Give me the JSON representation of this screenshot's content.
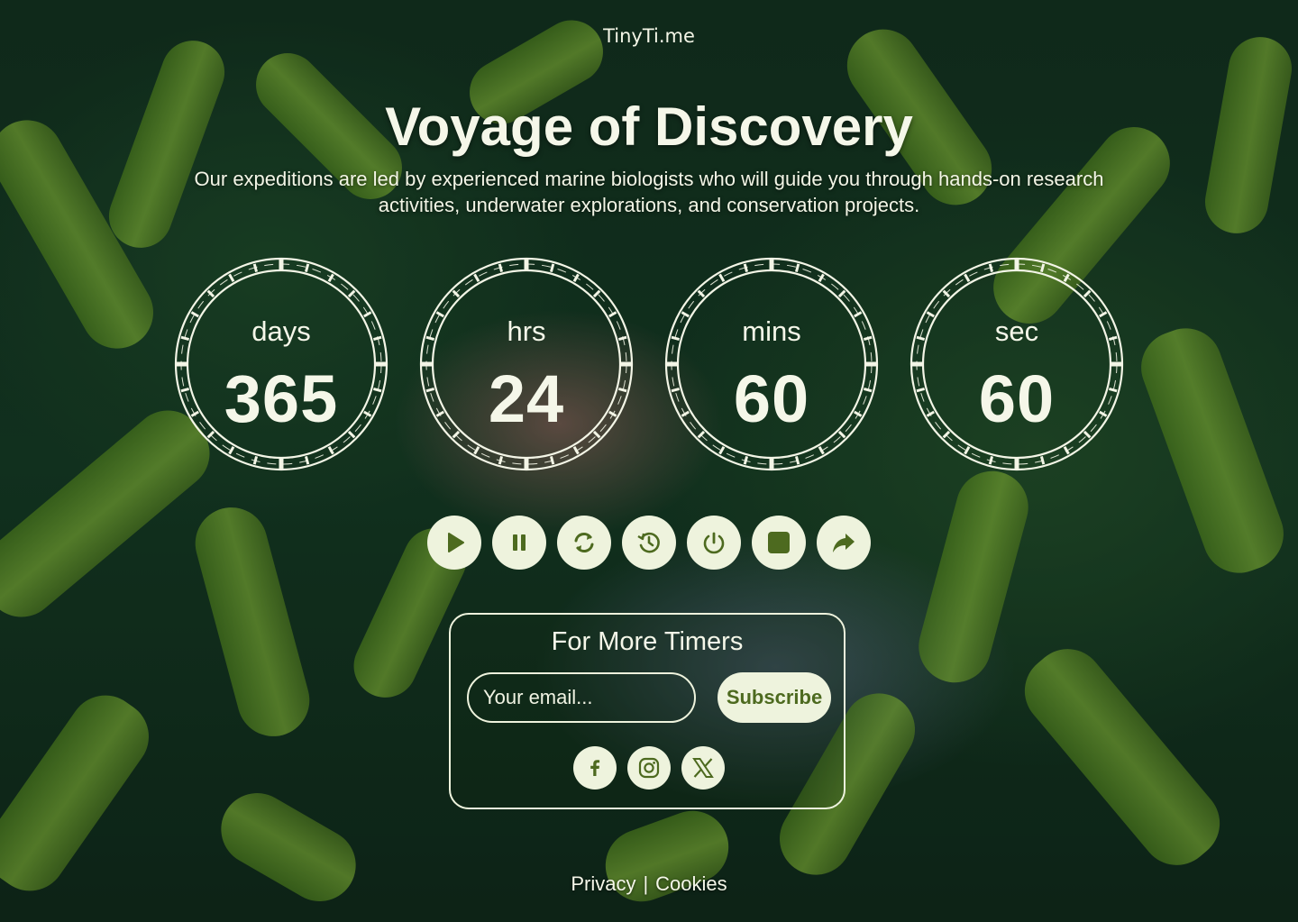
{
  "brand": "TinyTi.me",
  "hero": {
    "title": "Voyage of Discovery",
    "subtitle": "Our expeditions are led by experienced marine biologists who will guide you through hands-on research activities, underwater explorations, and conservation projects."
  },
  "timer": [
    {
      "unit": "days",
      "value": "365"
    },
    {
      "unit": "hrs",
      "value": "24"
    },
    {
      "unit": "mins",
      "value": "60"
    },
    {
      "unit": "sec",
      "value": "60"
    }
  ],
  "controls": [
    {
      "name": "play-icon"
    },
    {
      "name": "pause-icon"
    },
    {
      "name": "refresh-icon"
    },
    {
      "name": "history-icon"
    },
    {
      "name": "power-icon"
    },
    {
      "name": "stop-icon"
    },
    {
      "name": "share-icon"
    }
  ],
  "subscribe": {
    "title": "For More Timers",
    "placeholder": "Your email...",
    "button": "Subscribe"
  },
  "social": [
    "facebook-icon",
    "instagram-icon",
    "x-icon"
  ],
  "footer": {
    "privacy": "Privacy",
    "separator": "|",
    "cookies": "Cookies"
  },
  "colors": {
    "accent": "#eef3dd",
    "icon": "#4d6a1f"
  }
}
